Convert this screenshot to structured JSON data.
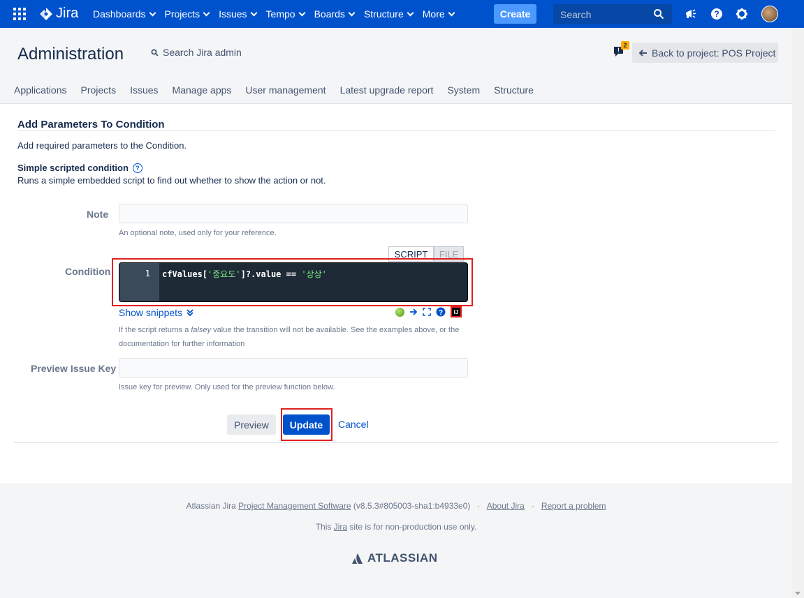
{
  "topnav": {
    "logo_text": "Jira",
    "items": [
      {
        "label": "Dashboards"
      },
      {
        "label": "Projects"
      },
      {
        "label": "Issues"
      },
      {
        "label": "Tempo"
      },
      {
        "label": "Boards"
      },
      {
        "label": "Structure"
      },
      {
        "label": "More"
      }
    ],
    "create_label": "Create",
    "search_placeholder": "Search",
    "icons": [
      "apps-grid-icon",
      "megaphone-icon",
      "help-icon",
      "gear-icon",
      "user-avatar"
    ]
  },
  "admin": {
    "title": "Administration",
    "search_label": "Search Jira admin",
    "feedback_badge": "2",
    "back_label": "Back to project: POS Project",
    "tabs": [
      "Applications",
      "Projects",
      "Issues",
      "Manage apps",
      "User management",
      "Latest upgrade report",
      "System",
      "Structure"
    ]
  },
  "form": {
    "title": "Add Parameters To Condition",
    "description": "Add required parameters to the Condition.",
    "condition_type": "Simple scripted condition",
    "condition_desc": "Runs a simple embedded script to find out whether to show the action or not.",
    "note_label": "Note",
    "note_value": "",
    "note_help": "An optional note, used only for your reference.",
    "condition_label": "Condition",
    "tab_script": "SCRIPT",
    "tab_file": "FILE",
    "code_line_number": "1",
    "code_prefix": "cfValues[",
    "code_str1": "'중요도'",
    "code_mid": "]?.value == ",
    "code_str2": "'상상'",
    "show_snippets": "Show snippets",
    "condition_help_1a": "If the script returns a ",
    "condition_help_italic": "falsey",
    "condition_help_1b": " value the transition will not be available. See the examples above, or the",
    "condition_help_2": "documentation for further information",
    "preview_key_label": "Preview Issue Key",
    "preview_key_value": "",
    "preview_key_help": "Issue key for preview. Only used for the preview function below.",
    "preview_button": "Preview",
    "update_button": "Update",
    "cancel_link": "Cancel"
  },
  "footer": {
    "prefix": "Atlassian Jira ",
    "pms_link": "Project Management Software",
    "version": " (v8.5.3#805003-sha1:b4933e0)",
    "sep": "·",
    "about_link": "About Jira",
    "report_link": "Report a problem",
    "line2_prefix": "This ",
    "line2_link": "Jira",
    "line2_suffix": " site is for non-production use only.",
    "brand": "ATLASSIAN"
  },
  "colors": {
    "nav_bg": "#0052cc",
    "create_bg": "#4c9aff",
    "highlight": "#e02020",
    "editor_bg": "#1e2a36"
  }
}
